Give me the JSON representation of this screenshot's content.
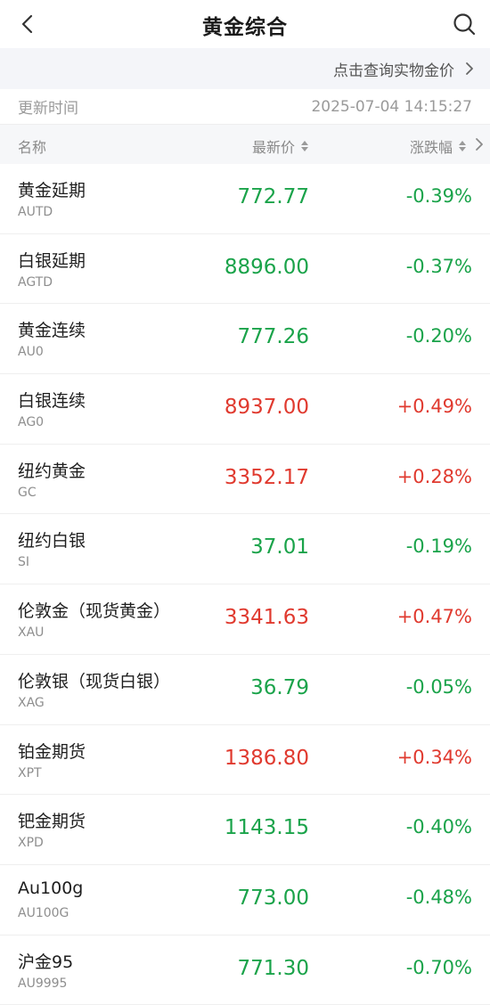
{
  "nav": {
    "title": "黄金综合",
    "back_icon": "chevron-left-icon",
    "search_icon": "search-icon"
  },
  "banner": {
    "text": "点击查询实物金价",
    "icon": "chevron-right-icon"
  },
  "update": {
    "label": "更新时间",
    "time": "2025-07-04 14:15:27"
  },
  "columns": {
    "name": "名称",
    "price": "最新价",
    "change": "涨跌幅"
  },
  "colors": {
    "up": "#e03a2f",
    "down": "#1aa34a"
  },
  "rows": [
    {
      "name": "黄金延期",
      "code": "AUTD",
      "price": "772.77",
      "change": "-0.39%",
      "dir": "down"
    },
    {
      "name": "白银延期",
      "code": "AGTD",
      "price": "8896.00",
      "change": "-0.37%",
      "dir": "down"
    },
    {
      "name": "黄金连续",
      "code": "AU0",
      "price": "777.26",
      "change": "-0.20%",
      "dir": "down"
    },
    {
      "name": "白银连续",
      "code": "AG0",
      "price": "8937.00",
      "change": "+0.49%",
      "dir": "up"
    },
    {
      "name": "纽约黄金",
      "code": "GC",
      "price": "3352.17",
      "change": "+0.28%",
      "dir": "up"
    },
    {
      "name": "纽约白银",
      "code": "SI",
      "price": "37.01",
      "change": "-0.19%",
      "dir": "down"
    },
    {
      "name": "伦敦金（现货黄金）",
      "code": "XAU",
      "price": "3341.63",
      "change": "+0.47%",
      "dir": "up"
    },
    {
      "name": "伦敦银（现货白银）",
      "code": "XAG",
      "price": "36.79",
      "change": "-0.05%",
      "dir": "down"
    },
    {
      "name": "铂金期货",
      "code": "XPT",
      "price": "1386.80",
      "change": "+0.34%",
      "dir": "up"
    },
    {
      "name": "钯金期货",
      "code": "XPD",
      "price": "1143.15",
      "change": "-0.40%",
      "dir": "down"
    },
    {
      "name": "Au100g",
      "code": "AU100G",
      "price": "773.00",
      "change": "-0.48%",
      "dir": "down"
    },
    {
      "name": "沪金95",
      "code": "AU9995",
      "price": "771.30",
      "change": "-0.70%",
      "dir": "down"
    }
  ]
}
